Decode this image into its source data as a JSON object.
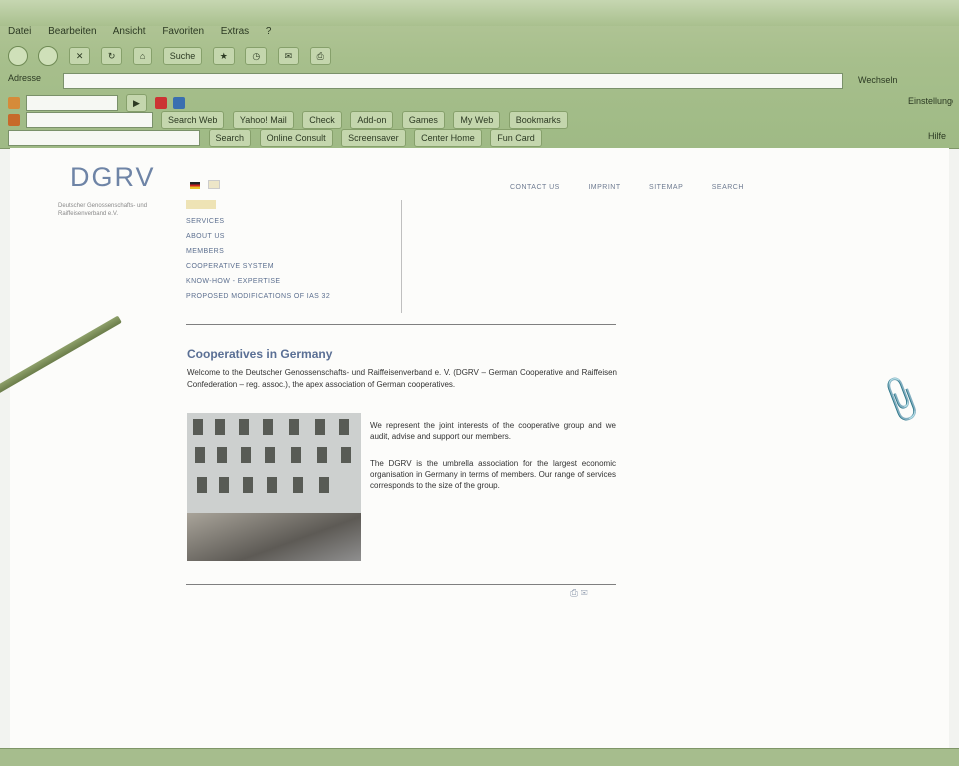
{
  "browser": {
    "menu": [
      "Datei",
      "Bearbeiten",
      "Ansicht",
      "Favoriten",
      "Extras",
      "?"
    ],
    "address_label": "Adresse",
    "address_value": "",
    "toolbar_search_label": "Suche",
    "toolbar2_items": [
      "Search Web",
      "Yahoo! Mail",
      "Check",
      "Add-on",
      "Games",
      "My Web",
      "Bookmarks"
    ],
    "toolbar3_items": [
      "Search",
      "Online Consult",
      "Screensaver",
      "Center Home",
      "Fun Card"
    ],
    "right_labels": [
      "Wechseln",
      "Einstellungen",
      "Hilfe"
    ]
  },
  "page": {
    "logo": "DGRV",
    "logo_sub": "Deutscher Genossenschafts- und Raiffeisenverband e.V.",
    "top_nav": [
      "CONTACT US",
      "IMPRINT",
      "SITEMAP",
      "SEARCH"
    ],
    "menu": [
      "SERVICES",
      "ABOUT US",
      "MEMBERS",
      "COOPERATIVE SYSTEM",
      "KNOW-HOW - EXPERTISE",
      "PROPOSED MODIFICATIONS OF IAS 32"
    ],
    "heading": "Cooperatives in Germany",
    "intro": "Welcome to the Deutscher Genossenschafts- und Raiffeisenverband e. V. (DGRV – German Cooperative and Raiffeisen Confederation – reg. assoc.), the apex association of German cooperatives.",
    "para1": "We represent the joint interests of the cooperative group and we audit, advise and support our members.",
    "para2": "The DGRV is the umbrella association for the largest economic organisation in Germany in terms of members. Our range of services corresponds to the size of the group."
  },
  "colors": {
    "chrome": "#a7bf8c",
    "link": "#5c6f8f",
    "heading": "#5a6f94"
  }
}
